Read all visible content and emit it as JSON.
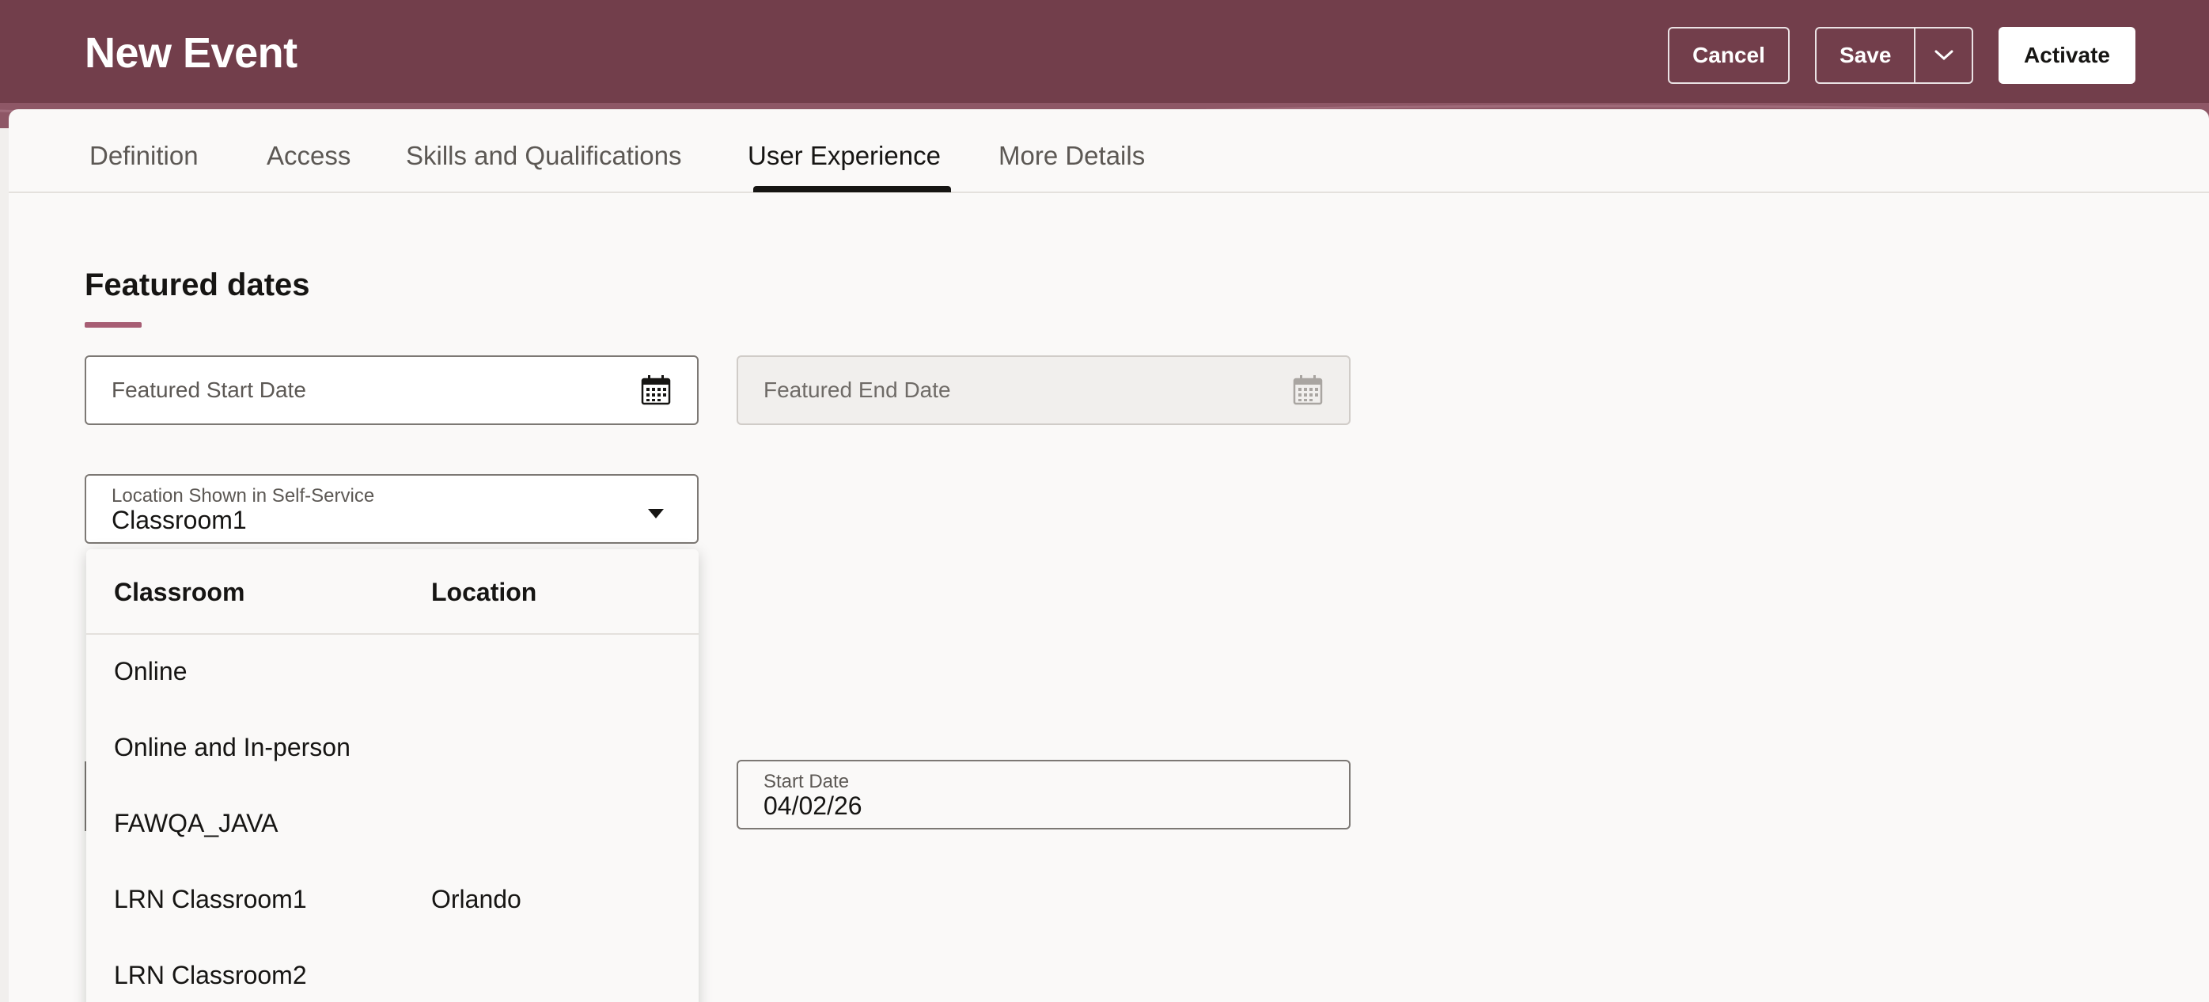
{
  "header": {
    "title": "New Event",
    "cancel_label": "Cancel",
    "save_label": "Save",
    "activate_label": "Activate",
    "bg_color": "#723e4b"
  },
  "tabs": [
    {
      "label": "Definition"
    },
    {
      "label": "Access"
    },
    {
      "label": "Skills and Qualifications"
    },
    {
      "label": "User Experience",
      "active": true
    },
    {
      "label": "More Details"
    }
  ],
  "section": {
    "title": "Featured dates"
  },
  "fields": {
    "featured_start": {
      "placeholder": "Featured Start Date"
    },
    "featured_end": {
      "placeholder": "Featured End Date",
      "disabled": true
    },
    "location": {
      "label": "Location Shown in Self-Service",
      "value": "Classroom1"
    },
    "start_date": {
      "label": "Start Date",
      "value": "04/02/26"
    }
  },
  "dropdown": {
    "columns": [
      "Classroom",
      "Location"
    ],
    "rows": [
      {
        "classroom": "Online",
        "location": ""
      },
      {
        "classroom": "Online and In-person",
        "location": ""
      },
      {
        "classroom": "FAWQA_JAVA",
        "location": ""
      },
      {
        "classroom": "LRN Classroom1",
        "location": "Orlando"
      },
      {
        "classroom": "LRN Classroom2",
        "location": ""
      }
    ]
  }
}
